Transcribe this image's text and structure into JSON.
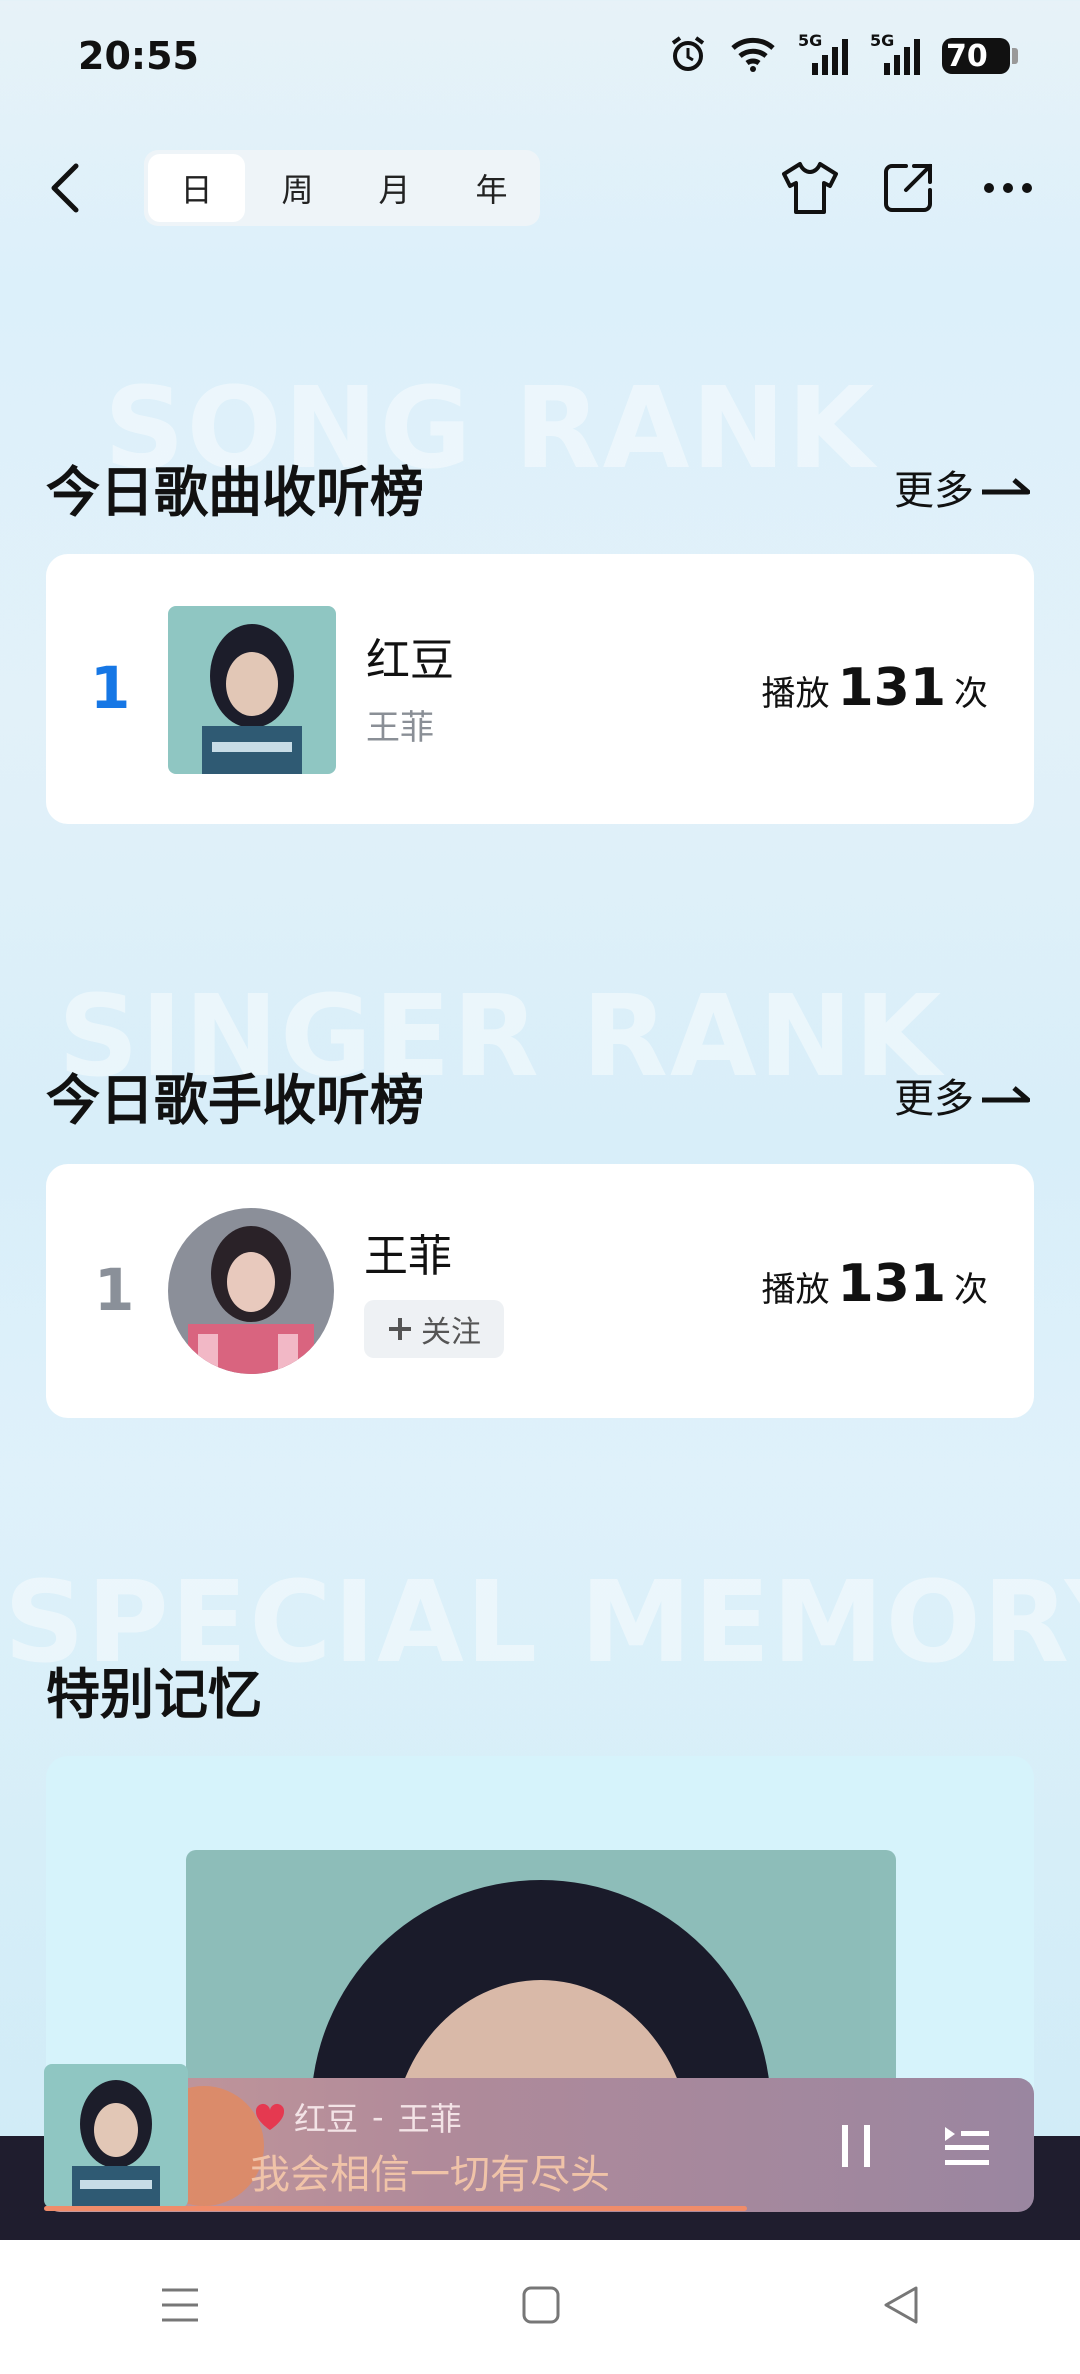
{
  "status_bar": {
    "time": "20:55",
    "battery": "70",
    "signal_label_1": "5G",
    "signal_label_2": "5G"
  },
  "nav": {
    "tabs": [
      "日",
      "周",
      "月",
      "年"
    ],
    "active_tab": "日",
    "icons": [
      "back-icon",
      "tshirt-icon",
      "share-icon",
      "more-icon"
    ]
  },
  "song_rank": {
    "watermark": "SONG RANK",
    "title": "今日歌曲收听榜",
    "more": "更多",
    "items": [
      {
        "rank": "1",
        "title": "红豆",
        "artist": "王菲",
        "plays_prefix": "播放",
        "plays": "131",
        "plays_suffix": "次"
      }
    ]
  },
  "singer_rank": {
    "watermark": "SINGER RANK",
    "title": "今日歌手收听榜",
    "more": "更多",
    "items": [
      {
        "rank": "1",
        "name": "王菲",
        "follow": "关注",
        "plays_prefix": "播放",
        "plays": "131",
        "plays_suffix": "次"
      }
    ]
  },
  "special_memory": {
    "watermark": "SPECIAL MEMORY",
    "title": "特别记忆"
  },
  "player": {
    "song": "红豆",
    "separator": "-",
    "artist": "王菲",
    "lyric": "我会相信一切有尽头",
    "progress": 0.71,
    "liked": true
  },
  "colors": {
    "rank_first": "#1677e5",
    "rank_other": "#8a9099",
    "accent": "#f08c6a"
  }
}
